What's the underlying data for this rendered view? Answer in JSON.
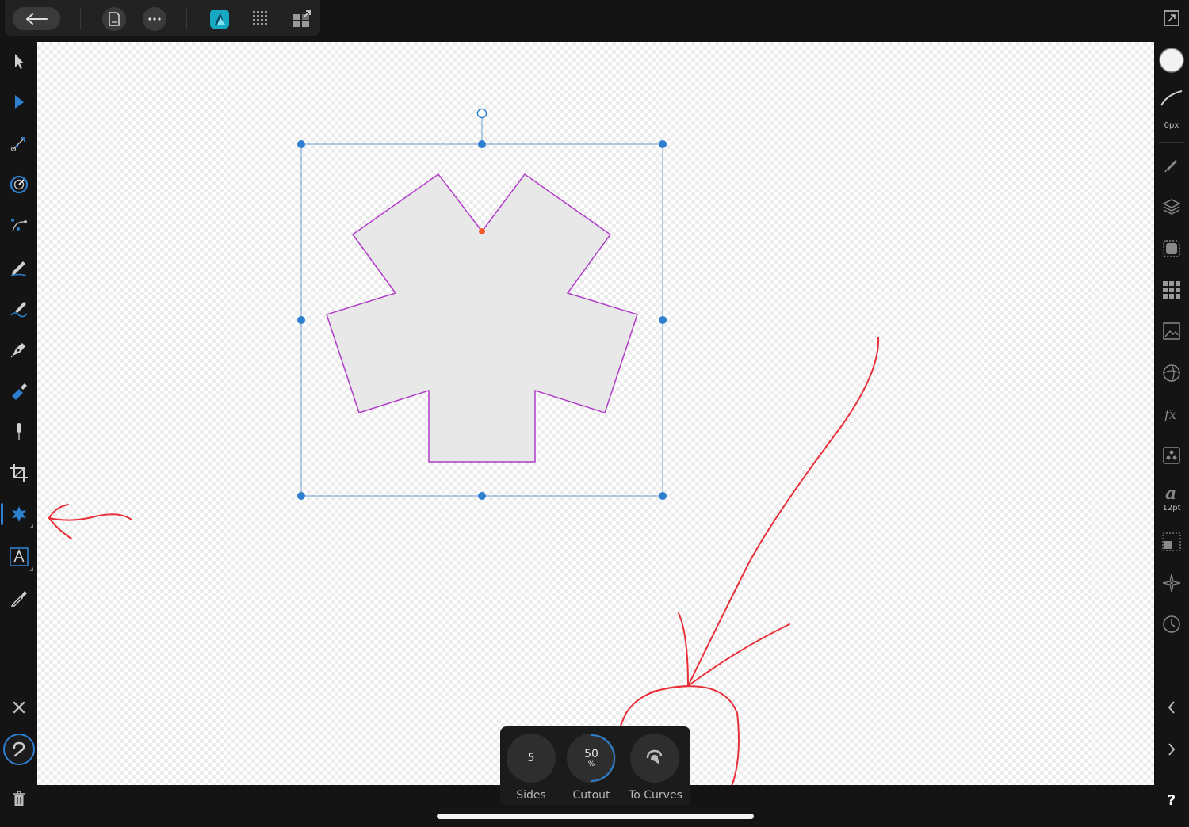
{
  "app": {
    "name": "Affinity Designer",
    "accent": "#2f7fd0",
    "annotation_color": "#e8303a"
  },
  "topbar": {
    "back": "back-arrow-icon",
    "document": "document-icon",
    "more": "more-icon",
    "persona": "designer-persona-icon",
    "pixel_persona": "pixel-persona-icon",
    "export_persona": "export-persona-icon"
  },
  "left_tools": [
    "move-tool-icon",
    "node-tool-icon",
    "corner-tool-icon",
    "point-transform-icon",
    "vector-brush-icon",
    "pencil-tool-icon",
    "vector-crop-icon",
    "pen-tool-icon",
    "fill-tool-icon",
    "transparency-tool-icon",
    "crop-tool-icon",
    "shape-tool-icon",
    "text-tool-icon",
    "color-picker-icon"
  ],
  "left_bottom": [
    "close-icon",
    "help-assistant-icon",
    "trash-icon"
  ],
  "right_panel": {
    "stroke_width": "0px",
    "font_size": "12pt",
    "items": [
      "fill-swatch",
      "stroke-style-icon",
      "brushes-icon",
      "layers-icon",
      "appearance-icon",
      "swatches-icon",
      "image-icon",
      "adjustments-icon",
      "effects-icon",
      "styles-icon",
      "text-styles-icon",
      "transform-icon",
      "navigator-icon",
      "history-icon"
    ],
    "help": "?"
  },
  "context_toolbar": {
    "sides": {
      "value": "5",
      "label": "Sides"
    },
    "cutout": {
      "value": "50",
      "unit": "%",
      "label": "Cutout"
    },
    "to_curves": {
      "label": "To Curves"
    }
  },
  "shape": {
    "fill": "#e8e8e8",
    "stroke": "#b03cc8",
    "selection_color": "#2f7fd0"
  }
}
